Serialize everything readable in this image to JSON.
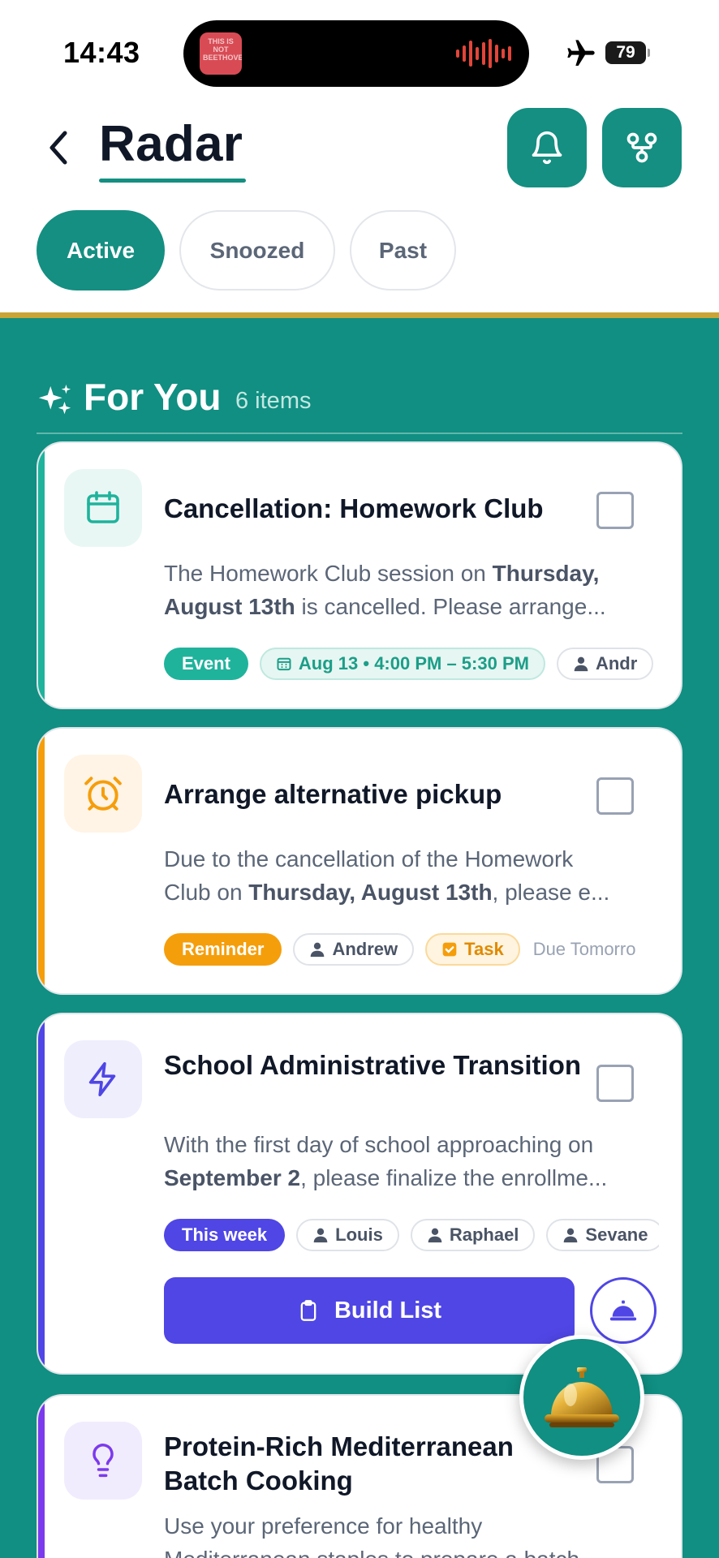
{
  "status_bar": {
    "time": "14:43",
    "album_text": "THIS IS NOT BEETHOVEN",
    "battery": "79"
  },
  "header": {
    "title": "Radar",
    "back_icon": "chevron-left-icon",
    "bell_icon": "bell-icon",
    "fork_icon": "git-fork-icon"
  },
  "tabs": [
    {
      "label": "Active",
      "selected": true
    },
    {
      "label": "Snoozed",
      "selected": false
    },
    {
      "label": "Past",
      "selected": false
    }
  ],
  "section": {
    "title": "For You",
    "count": "6 items"
  },
  "cards": [
    {
      "title": "Cancellation: Homework Club",
      "icon": "calendar-icon",
      "accent": "#1fb39c",
      "desc_line1_a": "The Homework Club session on ",
      "desc_line1_b": "Thursday,",
      "desc_line2_b": "August 13th",
      "desc_line2_c": " is cancelled. Please arrange...",
      "chips": {
        "type": "Event",
        "date": "Aug 13 • 4:00 PM – 5:30 PM",
        "person": "Andr"
      }
    },
    {
      "title": "Arrange alternative pickup",
      "icon": "alarm-clock-icon",
      "accent": "#f59e0b",
      "desc_line1_a": "Due to the cancellation of the Homework",
      "desc_line2_a": "Club on ",
      "desc_line2_b": "Thursday, August 13th",
      "desc_line2_c": ", please e...",
      "chips": {
        "type": "Reminder",
        "person": "Andrew",
        "task": "Task",
        "due": "Due Tomorro"
      }
    },
    {
      "title": "School Administrative Transition",
      "icon": "lightning-icon",
      "accent": "#4f46e5",
      "desc_line1_a": "With the first day of school approaching on",
      "desc_line2_b": "September 2",
      "desc_line2_c": ", please finalize the enrollme...",
      "chips": {
        "type": "This week",
        "person1": "Louis",
        "person2": "Raphael",
        "person3": "Sevane"
      },
      "button_label": "Build List"
    },
    {
      "title": "Protein-Rich Mediterranean Batch Cooking",
      "icon": "lightbulb-icon",
      "accent": "#7c3aed",
      "desc_line1_a": "Use your preference for healthy",
      "desc_line2_a": "Mediterranean staples to prepare a batch"
    }
  ],
  "fab_icon": "concierge-bell-icon",
  "colors": {
    "brand": "#148f82",
    "gold": "#c9a437",
    "indigo": "#4f46e5"
  }
}
